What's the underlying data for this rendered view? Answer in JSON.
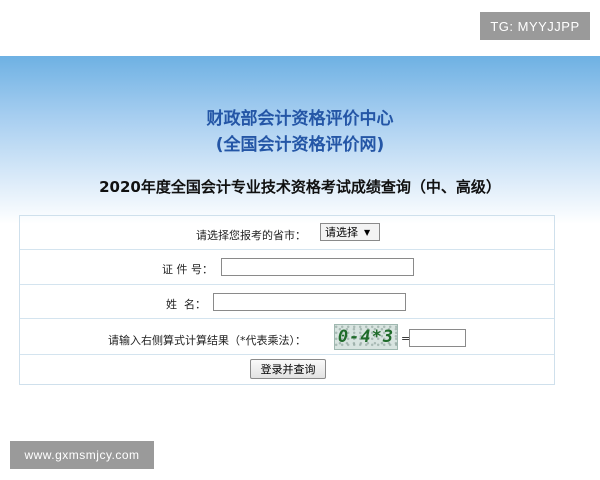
{
  "watermarks": {
    "top_right": "TG: MYYJJPP",
    "bottom_left": "www.gxmsmjcy.com"
  },
  "header": {
    "org_name": "财政部会计资格评价中心",
    "org_subname": "(全国会计资格评价网)",
    "query_title": "2020年度全国会计专业技术资格考试成绩查询（中、高级）"
  },
  "form": {
    "province_label": "请选择您报考的省市：",
    "province_selected": "请选择",
    "id_label": "证 件 号：",
    "id_value": "",
    "name_label": "姓  名：",
    "name_value": "",
    "captcha_label": "请输入右侧算式计算结果（*代表乘法）：",
    "captcha_text": "0-4*3",
    "captcha_equals": "=",
    "captcha_value": "",
    "submit_label": "登录并查询"
  }
}
